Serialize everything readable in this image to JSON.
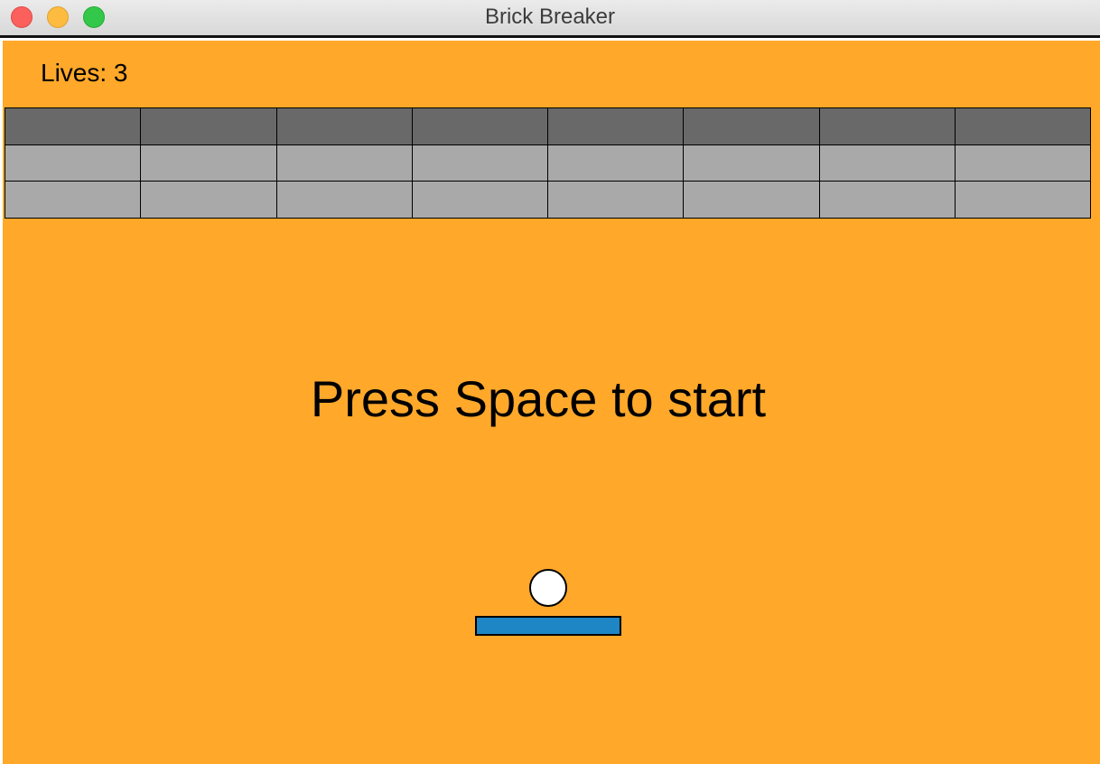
{
  "window": {
    "title": "Brick Breaker"
  },
  "hud": {
    "lives_text": "Lives: 3"
  },
  "message": "Press Space to start",
  "colors": {
    "background": "#ffa82a",
    "brick_dark": "#696969",
    "brick_light": "#a9a9a9",
    "paddle": "#1e86c4",
    "ball": "#ffffff"
  },
  "bricks": {
    "columns": 8,
    "rows": [
      "dark",
      "light",
      "light"
    ]
  }
}
